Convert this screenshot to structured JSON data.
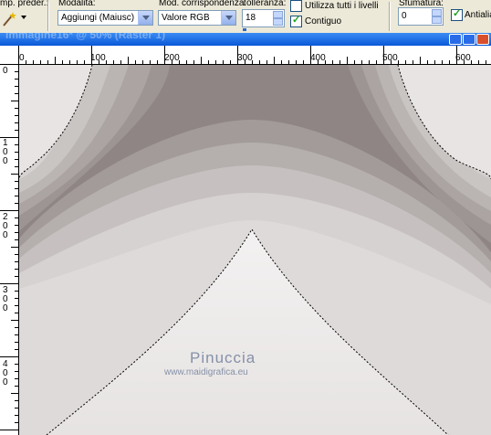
{
  "toolbar": {
    "preset_label": "mp. preder.:",
    "mode_label": "Modalità:",
    "mode_value": "Aggiungi (Maiusc)",
    "match_label": "Mod. corrispondenza:",
    "match_value": "Valore RGB",
    "tolerance_label": "Tolleranza:",
    "tolerance_value": "18",
    "use_all_layers_label": "Utilizza tutti i livelli",
    "use_all_layers_checked": false,
    "contiguous_label": "Contiguo",
    "contiguous_checked": true,
    "feather_label": "Sfumatura:",
    "feather_value": "0",
    "antialias_label": "Antialias",
    "antialias_checked": true
  },
  "window": {
    "title": "Immagine16* @ 50% (Raster 1)"
  },
  "ruler": {
    "h_ticks": [
      "0",
      "100",
      "200",
      "300",
      "400",
      "500",
      "600"
    ],
    "v_ticks": [
      "0",
      "100",
      "200",
      "300",
      "400"
    ]
  },
  "watermark": {
    "line1": "Pinuccia",
    "line2": "www.maidigrafica.eu"
  },
  "colors": {
    "selection_marquee": "#000000",
    "band_dark": "#8e8584",
    "band_light": "#e7e4e3"
  },
  "icons": {
    "tool": "magic-wand-icon"
  }
}
